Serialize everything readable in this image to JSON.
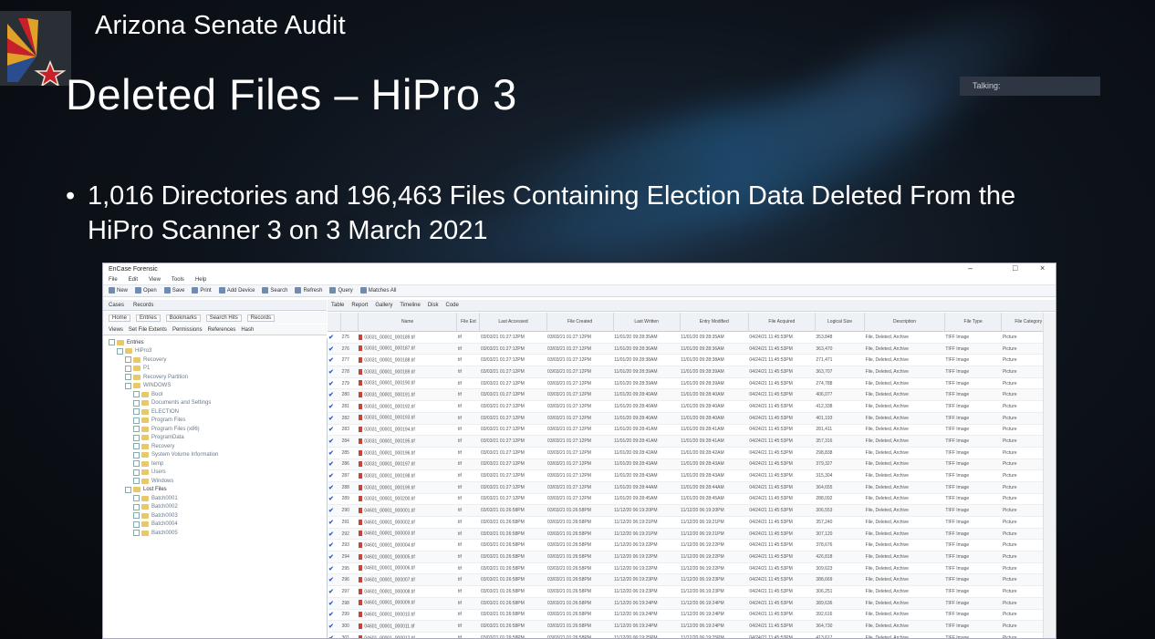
{
  "slide": {
    "app_title": "Arizona Senate Audit",
    "title": "Deleted Files – HiPro 3",
    "bullet": "1,016 Directories and 196,463 Files Containing Election Data Deleted From the HiPro Scanner 3 on 3 March 2021",
    "talking_label": "Talking:"
  },
  "window": {
    "title": "EnCase Forensic",
    "controls": [
      "–",
      "□",
      "×"
    ],
    "menu": [
      "File",
      "Edit",
      "View",
      "Tools",
      "Help"
    ],
    "toolbar": [
      "New",
      "Open",
      "Save",
      "Print",
      "Add Device",
      "Search",
      "Refresh",
      "Query",
      "Matches All"
    ],
    "left_tabs": [
      "Cases",
      "Records"
    ],
    "left_subtabs": [
      "Home",
      "Entries",
      "Bookmarks",
      "Search Hits",
      "Records"
    ],
    "left_subtabs2": [
      "Views",
      "Set File Extents",
      "Permissions",
      "References",
      "Hash"
    ],
    "tree": [
      {
        "label": "Entries",
        "level": 0
      },
      {
        "label": "HiPro3",
        "level": 1
      },
      {
        "label": "Recovery",
        "level": 2
      },
      {
        "label": "P1",
        "level": 2
      },
      {
        "label": "Recovery Partition",
        "level": 2
      },
      {
        "label": "WINDOWS",
        "level": 2
      },
      {
        "label": "Boot",
        "level": 3
      },
      {
        "label": "Documents and Settings",
        "level": 3
      },
      {
        "label": "ELECTION",
        "level": 3
      },
      {
        "label": "Program Files",
        "level": 3
      },
      {
        "label": "Program Files (x86)",
        "level": 3
      },
      {
        "label": "ProgramData",
        "level": 3
      },
      {
        "label": "Recovery",
        "level": 3
      },
      {
        "label": "System Volume Information",
        "level": 3
      },
      {
        "label": "temp",
        "level": 3
      },
      {
        "label": "Users",
        "level": 3
      },
      {
        "label": "Windows",
        "level": 3
      },
      {
        "label": "Lost Files",
        "level": 2
      },
      {
        "label": "Batch0001",
        "level": 3
      },
      {
        "label": "Batch0002",
        "level": 3
      },
      {
        "label": "Batch0003",
        "level": 3
      },
      {
        "label": "Batch0004",
        "level": 3
      },
      {
        "label": "Batch0005",
        "level": 3
      }
    ],
    "right_tabs": [
      "Table",
      "Report",
      "Gallery",
      "Timeline",
      "Disk",
      "Code"
    ],
    "columns": [
      "",
      "",
      "Name",
      "File Ext",
      "Last Accessed",
      "File Created",
      "Last Written",
      "Entry Modified",
      "File Acquired",
      "Logical Size",
      "Description",
      "File Type",
      "File Category"
    ],
    "rows": [
      [
        "275",
        "03031_00001_000189.tif",
        "tif",
        "03/03/21 01:27:12PM",
        "03/03/21 01:27:12PM",
        "11/01/20 09:28:35AM",
        "11/01/20 09:28:35AM",
        "04/24/21 11:45:53PM",
        "353,848",
        "File, Deleted, Archive",
        "TIFF Image",
        "Picture"
      ],
      [
        "276",
        "03031_00001_000187.tif",
        "tif",
        "03/03/21 01:27:12PM",
        "03/03/21 01:27:12PM",
        "11/01/20 09:28:36AM",
        "11/01/20 09:28:36AM",
        "04/24/21 11:45:53PM",
        "363,470",
        "File, Deleted, Archive",
        "TIFF Image",
        "Picture"
      ],
      [
        "277",
        "03031_00001_000188.tif",
        "tif",
        "03/03/21 01:27:12PM",
        "03/03/21 01:27:12PM",
        "11/01/20 09:28:38AM",
        "11/01/20 09:28:38AM",
        "04/24/21 11:45:53PM",
        "271,471",
        "File, Deleted, Archive",
        "TIFF Image",
        "Picture"
      ],
      [
        "278",
        "03031_00001_000189.tif",
        "tif",
        "03/03/21 01:27:12PM",
        "03/03/21 01:27:12PM",
        "11/01/20 09:28:39AM",
        "11/01/20 09:28:39AM",
        "04/24/21 11:45:53PM",
        "363,707",
        "File, Deleted, Archive",
        "TIFF Image",
        "Picture"
      ],
      [
        "279",
        "03031_00001_000190.tif",
        "tif",
        "03/03/21 01:27:12PM",
        "03/03/21 01:27:12PM",
        "11/01/20 09:28:39AM",
        "11/01/20 09:28:39AM",
        "04/24/21 11:45:53PM",
        "274,788",
        "File, Deleted, Archive",
        "TIFF Image",
        "Picture"
      ],
      [
        "280",
        "03031_00001_000191.tif",
        "tif",
        "03/03/21 01:27:12PM",
        "03/03/21 01:27:12PM",
        "11/01/20 09:28:40AM",
        "11/01/20 09:28:40AM",
        "04/24/21 11:45:53PM",
        "406,077",
        "File, Deleted, Archive",
        "TIFF Image",
        "Picture"
      ],
      [
        "281",
        "03031_00001_000192.tif",
        "tif",
        "03/03/21 01:27:12PM",
        "03/03/21 01:27:12PM",
        "11/01/20 09:28:40AM",
        "11/01/20 09:28:40AM",
        "04/24/21 11:45:53PM",
        "412,338",
        "File, Deleted, Archive",
        "TIFF Image",
        "Picture"
      ],
      [
        "282",
        "03031_00001_000193.tif",
        "tif",
        "03/03/21 01:27:12PM",
        "03/03/21 01:27:12PM",
        "11/01/20 09:28:40AM",
        "11/01/20 09:28:40AM",
        "04/24/21 11:45:53PM",
        "401,193",
        "File, Deleted, Archive",
        "TIFF Image",
        "Picture"
      ],
      [
        "283",
        "03031_00001_000194.tif",
        "tif",
        "03/03/21 01:27:12PM",
        "03/03/21 01:27:12PM",
        "11/01/20 09:28:41AM",
        "11/01/20 09:28:41AM",
        "04/24/21 11:45:53PM",
        "281,411",
        "File, Deleted, Archive",
        "TIFF Image",
        "Picture"
      ],
      [
        "284",
        "03031_00001_000195.tif",
        "tif",
        "03/03/21 01:27:12PM",
        "03/03/21 01:27:12PM",
        "11/01/20 09:28:41AM",
        "11/01/20 09:28:41AM",
        "04/24/21 11:45:53PM",
        "357,316",
        "File, Deleted, Archive",
        "TIFF Image",
        "Picture"
      ],
      [
        "285",
        "03031_00001_000196.tif",
        "tif",
        "03/03/21 01:27:12PM",
        "03/03/21 01:27:12PM",
        "11/01/20 09:28:42AM",
        "11/01/20 09:28:42AM",
        "04/24/21 11:45:53PM",
        "298,838",
        "File, Deleted, Archive",
        "TIFF Image",
        "Picture"
      ],
      [
        "286",
        "03031_00001_000197.tif",
        "tif",
        "03/03/21 01:27:12PM",
        "03/03/21 01:27:12PM",
        "11/01/20 09:28:43AM",
        "11/01/20 09:28:43AM",
        "04/24/21 11:45:53PM",
        "379,327",
        "File, Deleted, Archive",
        "TIFF Image",
        "Picture"
      ],
      [
        "287",
        "03031_00001_000198.tif",
        "tif",
        "03/03/21 01:27:12PM",
        "03/03/21 01:27:12PM",
        "11/01/20 09:28:43AM",
        "11/01/20 09:28:43AM",
        "04/24/21 11:45:53PM",
        "315,304",
        "File, Deleted, Archive",
        "TIFF Image",
        "Picture"
      ],
      [
        "288",
        "03031_00001_000199.tif",
        "tif",
        "03/03/21 01:27:12PM",
        "03/03/21 01:27:12PM",
        "11/01/20 09:28:44AM",
        "11/01/20 09:28:44AM",
        "04/24/21 11:45:53PM",
        "364,655",
        "File, Deleted, Archive",
        "TIFF Image",
        "Picture"
      ],
      [
        "289",
        "03031_00001_000200.tif",
        "tif",
        "03/03/21 01:27:12PM",
        "03/03/21 01:27:12PM",
        "11/01/20 09:28:45AM",
        "11/01/20 09:28:45AM",
        "04/24/21 11:45:53PM",
        "288,092",
        "File, Deleted, Archive",
        "TIFF Image",
        "Picture"
      ],
      [
        "290",
        "04601_00001_000001.tif",
        "tif",
        "03/03/21 01:26:58PM",
        "03/03/21 01:26:58PM",
        "11/12/20 06:19:20PM",
        "11/12/20 06:19:20PM",
        "04/24/21 11:45:53PM",
        "306,553",
        "File, Deleted, Archive",
        "TIFF Image",
        "Picture"
      ],
      [
        "291",
        "04601_00001_000002.tif",
        "tif",
        "03/03/21 01:26:58PM",
        "03/03/21 01:26:58PM",
        "11/12/20 06:19:21PM",
        "11/12/20 06:19:21PM",
        "04/24/21 11:45:53PM",
        "357,240",
        "File, Deleted, Archive",
        "TIFF Image",
        "Picture"
      ],
      [
        "292",
        "04601_00001_000003.tif",
        "tif",
        "03/03/21 01:26:58PM",
        "03/03/21 01:26:58PM",
        "11/12/20 06:19:21PM",
        "11/12/20 06:19:21PM",
        "04/24/21 11:45:53PM",
        "307,120",
        "File, Deleted, Archive",
        "TIFF Image",
        "Picture"
      ],
      [
        "293",
        "04601_00001_000004.tif",
        "tif",
        "03/03/21 01:26:58PM",
        "03/03/21 01:26:58PM",
        "11/12/20 06:19:22PM",
        "11/12/20 06:19:22PM",
        "04/24/21 11:45:53PM",
        "378,676",
        "File, Deleted, Archive",
        "TIFF Image",
        "Picture"
      ],
      [
        "294",
        "04601_00001_000005.tif",
        "tif",
        "03/03/21 01:26:58PM",
        "03/03/21 01:26:58PM",
        "11/12/20 06:19:22PM",
        "11/12/20 06:19:22PM",
        "04/24/21 11:45:53PM",
        "426,818",
        "File, Deleted, Archive",
        "TIFF Image",
        "Picture"
      ],
      [
        "295",
        "04601_00001_000006.tif",
        "tif",
        "03/03/21 01:26:58PM",
        "03/03/21 01:26:58PM",
        "11/12/20 06:19:22PM",
        "11/12/20 06:19:22PM",
        "04/24/21 11:45:53PM",
        "309,623",
        "File, Deleted, Archive",
        "TIFF Image",
        "Picture"
      ],
      [
        "296",
        "04601_00001_000007.tif",
        "tif",
        "03/03/21 01:26:58PM",
        "03/03/21 01:26:58PM",
        "11/12/20 06:19:23PM",
        "11/12/20 06:19:23PM",
        "04/24/21 11:45:53PM",
        "388,669",
        "File, Deleted, Archive",
        "TIFF Image",
        "Picture"
      ],
      [
        "297",
        "04601_00001_000008.tif",
        "tif",
        "03/03/21 01:26:58PM",
        "03/03/21 01:26:58PM",
        "11/12/20 06:19:23PM",
        "11/12/20 06:19:23PM",
        "04/24/21 11:45:53PM",
        "306,251",
        "File, Deleted, Archive",
        "TIFF Image",
        "Picture"
      ],
      [
        "298",
        "04601_00001_000009.tif",
        "tif",
        "03/03/21 01:26:58PM",
        "03/03/21 01:26:58PM",
        "11/12/20 06:19:24PM",
        "11/12/20 06:19:24PM",
        "04/24/21 11:45:53PM",
        "389,636",
        "File, Deleted, Archive",
        "TIFF Image",
        "Picture"
      ],
      [
        "299",
        "04601_00001_000010.tif",
        "tif",
        "03/03/21 01:26:58PM",
        "03/03/21 01:26:58PM",
        "11/12/20 06:19:24PM",
        "11/12/20 06:19:24PM",
        "04/24/21 11:45:53PM",
        "392,616",
        "File, Deleted, Archive",
        "TIFF Image",
        "Picture"
      ],
      [
        "300",
        "04601_00001_000011.tif",
        "tif",
        "03/03/21 01:26:58PM",
        "03/03/21 01:26:58PM",
        "11/12/20 06:19:24PM",
        "11/12/20 06:19:24PM",
        "04/24/21 11:45:53PM",
        "364,730",
        "File, Deleted, Archive",
        "TIFF Image",
        "Picture"
      ],
      [
        "301",
        "04601_00001_000012.tif",
        "tif",
        "03/03/21 01:26:58PM",
        "03/03/21 01:26:58PM",
        "11/12/20 06:19:25PM",
        "11/12/20 06:19:25PM",
        "04/24/21 11:45:53PM",
        "413,617",
        "File, Deleted, Archive",
        "TIFF Image",
        "Picture"
      ]
    ]
  }
}
